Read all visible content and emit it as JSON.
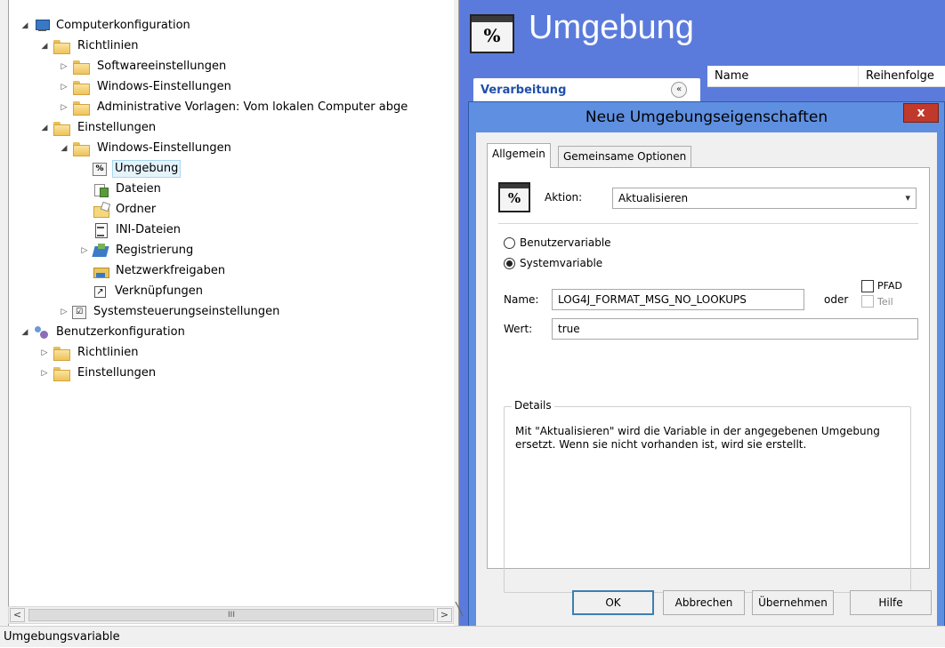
{
  "tree": [
    {
      "label": "Computerkonfiguration",
      "icon": "computer-icon",
      "expander": "◢"
    },
    {
      "label": "Richtlinien",
      "icon": "folder-icon",
      "expander": "◢"
    },
    {
      "label": "Softwareeinstellungen",
      "icon": "folder-icon",
      "expander": "▷"
    },
    {
      "label": "Windows-Einstellungen",
      "icon": "folder-icon",
      "expander": "▷"
    },
    {
      "label": "Administrative Vorlagen: Vom lokalen Computer abge",
      "icon": "folder-icon",
      "expander": "▷"
    },
    {
      "label": "Einstellungen",
      "icon": "folder-icon",
      "expander": "◢"
    },
    {
      "label": "Windows-Einstellungen",
      "icon": "folder-icon",
      "expander": "◢"
    },
    {
      "label": "Umgebung",
      "icon": "environment-icon",
      "expander": ""
    },
    {
      "label": "Dateien",
      "icon": "files-icon",
      "expander": ""
    },
    {
      "label": "Ordner",
      "icon": "folder-options-icon",
      "expander": ""
    },
    {
      "label": "INI-Dateien",
      "icon": "ini-file-icon",
      "expander": ""
    },
    {
      "label": "Registrierung",
      "icon": "registry-icon",
      "expander": "▷"
    },
    {
      "label": "Netzwerkfreigaben",
      "icon": "network-share-icon",
      "expander": ""
    },
    {
      "label": "Verknüpfungen",
      "icon": "shortcut-icon",
      "expander": ""
    },
    {
      "label": "Systemsteuerungseinstellungen",
      "icon": "control-panel-icon",
      "expander": "▷"
    },
    {
      "label": "Benutzerkonfiguration",
      "icon": "users-icon",
      "expander": "◢"
    },
    {
      "label": "Richtlinien",
      "icon": "folder-icon",
      "expander": "▷"
    },
    {
      "label": "Einstellungen",
      "icon": "folder-icon",
      "expander": "▷"
    }
  ],
  "scrollbar": {
    "left": "<",
    "right": ">",
    "grip": "III"
  },
  "status_bar": "Umgebungsvariable",
  "pane": {
    "icon_text": "%",
    "title": "Umgebung",
    "processing_label": "Verarbeitung",
    "collapse_glyph": "«",
    "columns": [
      "Name",
      "Reihenfolge"
    ]
  },
  "dialog": {
    "title": "Neue Umgebungseigenschaften",
    "close_glyph": "x",
    "tabs": [
      "Allgemein",
      "Gemeinsame Optionen"
    ],
    "action_label": "Aktion:",
    "action_value": "Aktualisieren",
    "radio_user": "Benutzervariable",
    "radio_system": "Systemvariable",
    "name_label": "Name:",
    "name_value": "LOG4J_FORMAT_MSG_NO_LOOKUPS",
    "or_label": "oder",
    "path_label": "PFAD",
    "part_label": "Teil",
    "value_label": "Wert:",
    "value_value": "true",
    "details_title": "Details",
    "details_text": "Mit \"Aktualisieren\" wird die Variable in der angegebenen Umgebung ersetzt. Wenn sie nicht vorhanden ist, wird sie erstellt.",
    "buttons": {
      "ok": "OK",
      "cancel": "Abbrechen",
      "apply": "Übernehmen",
      "help": "Hilfe"
    }
  }
}
